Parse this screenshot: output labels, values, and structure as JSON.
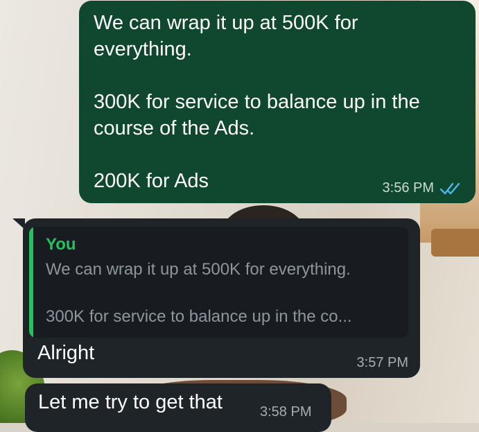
{
  "messages": {
    "outgoing": {
      "text": "We can wrap it up at 500K for\neverything.\n\n300K for service to balance up in the\ncourse of the Ads.\n\n200K for Ads",
      "time": "3:56 PM",
      "status_icon": "double-check-read-icon"
    },
    "reply": {
      "quoted_author": "You",
      "quoted_line1": "We can wrap it up at 500K for everything.",
      "quoted_line2": "300K for service to balance up in the co...",
      "text": "Alright",
      "time": "3:57 PM"
    },
    "incoming": {
      "text": "Let me try to get that",
      "time": "3:58 PM"
    }
  },
  "colors": {
    "outgoing_bubble": "#10472f",
    "incoming_bubble": "#1f2429",
    "quote_accent": "#25c161",
    "read_ticks": "#4fb6ec"
  }
}
